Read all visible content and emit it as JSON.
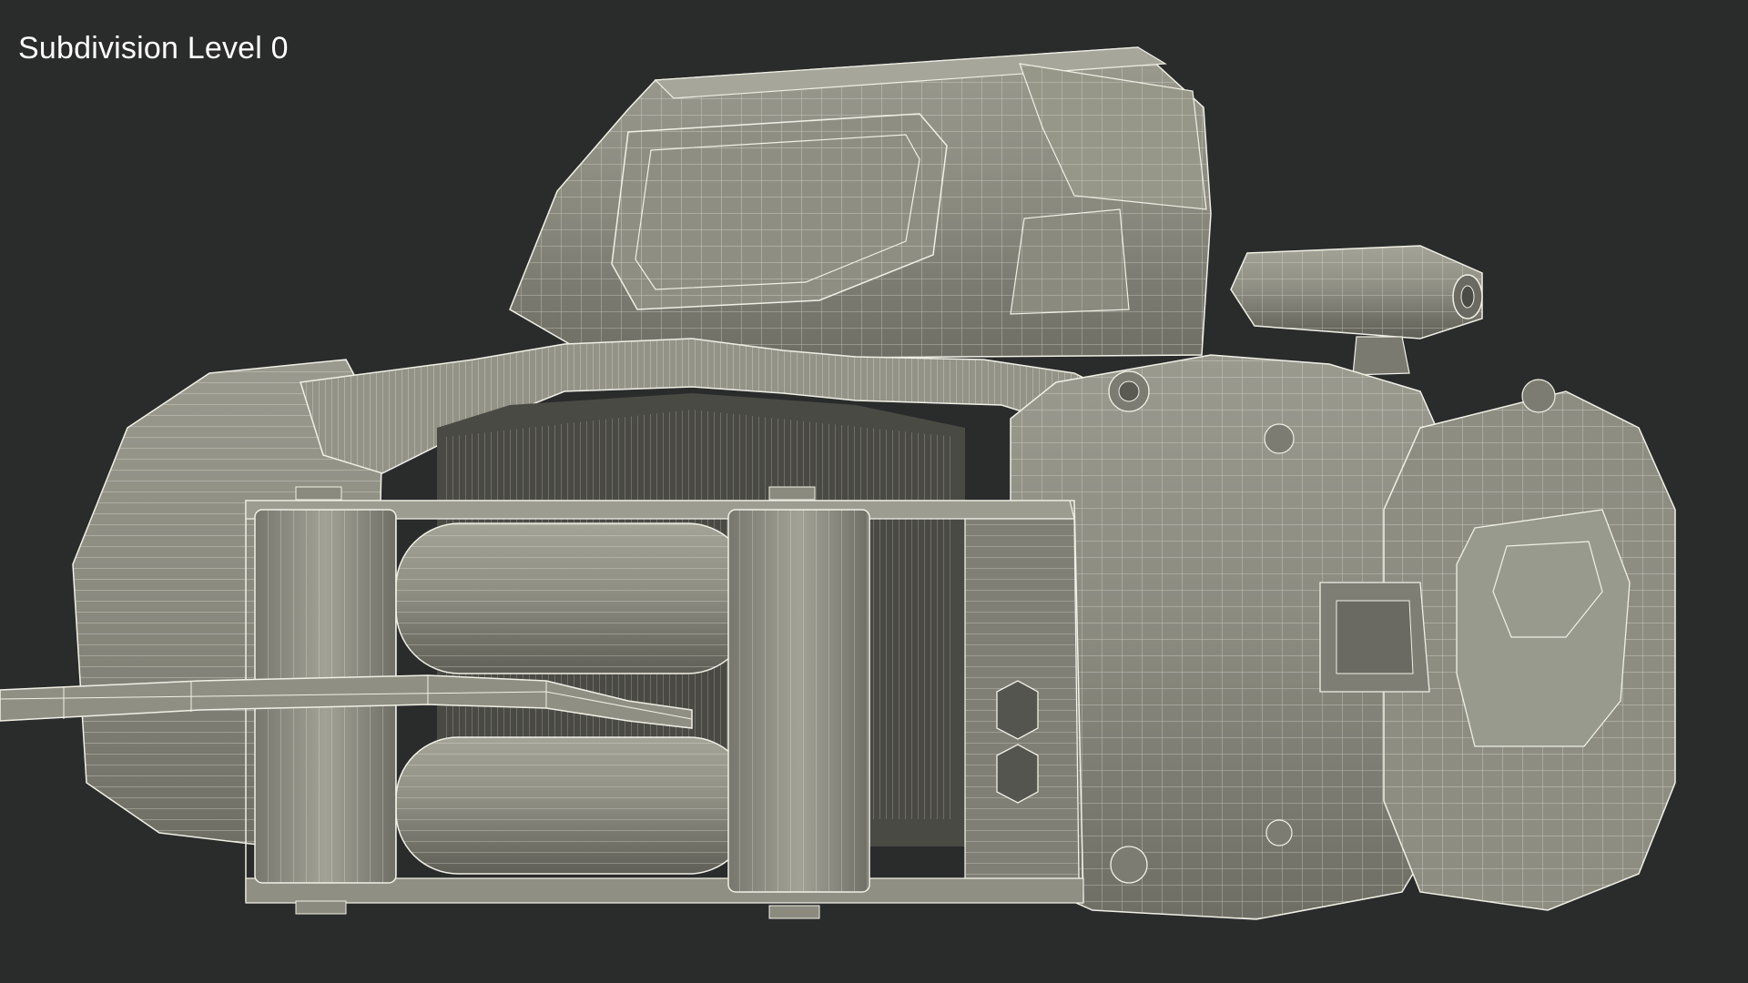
{
  "viewport": {
    "overlay_label": "Subdivision Level 0",
    "background_color": "#2a2b2b"
  },
  "model": {
    "subject": "winch-wireframe",
    "surface_color": "#8b8b80",
    "shadow_color": "#5e5e56",
    "wire_color": "#f2f2e8"
  }
}
